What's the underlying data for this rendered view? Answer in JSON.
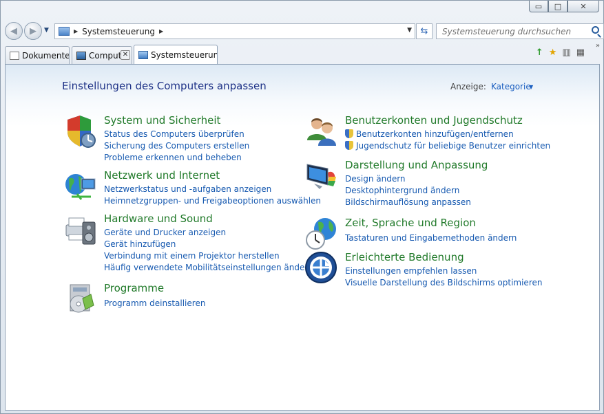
{
  "window": {
    "caption_buttons": {
      "minimize": "▭",
      "maximize": "□",
      "close": "✕"
    }
  },
  "nav": {
    "back_glyph": "◀",
    "forward_glyph": "▶",
    "address_segments": [
      "Systemsteuerung"
    ],
    "refresh_glyph": "⇆",
    "search_placeholder": "Systemsteuerung durchsuchen"
  },
  "tabs": [
    {
      "label": "Dokumente",
      "icon": "document-icon"
    },
    {
      "label": "Compute",
      "icon": "computer-icon"
    },
    {
      "label": "Systemsteuerung",
      "icon": "control-panel-icon"
    }
  ],
  "toolbar": {
    "up_glyph": "↑",
    "favorites_glyph": "★",
    "preview_glyph": "▥",
    "views_glyph": "▦",
    "more_glyph": "»"
  },
  "content": {
    "title": "Einstellungen des Computers anpassen",
    "view_label": "Anzeige:",
    "view_value": "Kategorie",
    "categories": [
      {
        "title": "System und Sicherheit",
        "icon": "security-shield-icon",
        "links": [
          "Status des Computers überprüfen",
          "Sicherung des Computers erstellen",
          "Probleme erkennen und beheben"
        ]
      },
      {
        "title": "Netzwerk und Internet",
        "icon": "network-globe-icon",
        "links": [
          "Netzwerkstatus und -aufgaben anzeigen",
          "Heimnetzgruppen- und Freigabeoptionen auswählen"
        ]
      },
      {
        "title": "Hardware und Sound",
        "icon": "printer-speaker-icon",
        "links": [
          "Geräte und Drucker anzeigen",
          "Gerät hinzufügen",
          "Verbindung mit einem Projektor herstellen",
          "Häufig verwendete Mobilitätseinstellungen ändern"
        ]
      },
      {
        "title": "Programme",
        "icon": "programs-box-icon",
        "links": [
          "Programm deinstallieren"
        ]
      },
      {
        "title": "Benutzerkonten und Jugendschutz",
        "icon": "users-icon",
        "links": [
          "Benutzerkonten hinzufügen/entfernen",
          "Jugendschutz für beliebige Benutzer einrichten"
        ]
      },
      {
        "title": "Darstellung und Anpassung",
        "icon": "display-paint-icon",
        "links": [
          "Design ändern",
          "Desktophintergrund ändern",
          "Bildschirmauflösung anpassen"
        ]
      },
      {
        "title": "Zeit, Sprache und Region",
        "icon": "clock-globe-icon",
        "links": [
          "Tastaturen und Eingabemethoden ändern"
        ]
      },
      {
        "title": "Erleichterte Bedienung",
        "icon": "ease-of-access-icon",
        "links": [
          "Einstellungen empfehlen lassen",
          "Visuelle Darstellung des Bildschirms optimieren"
        ]
      }
    ]
  }
}
